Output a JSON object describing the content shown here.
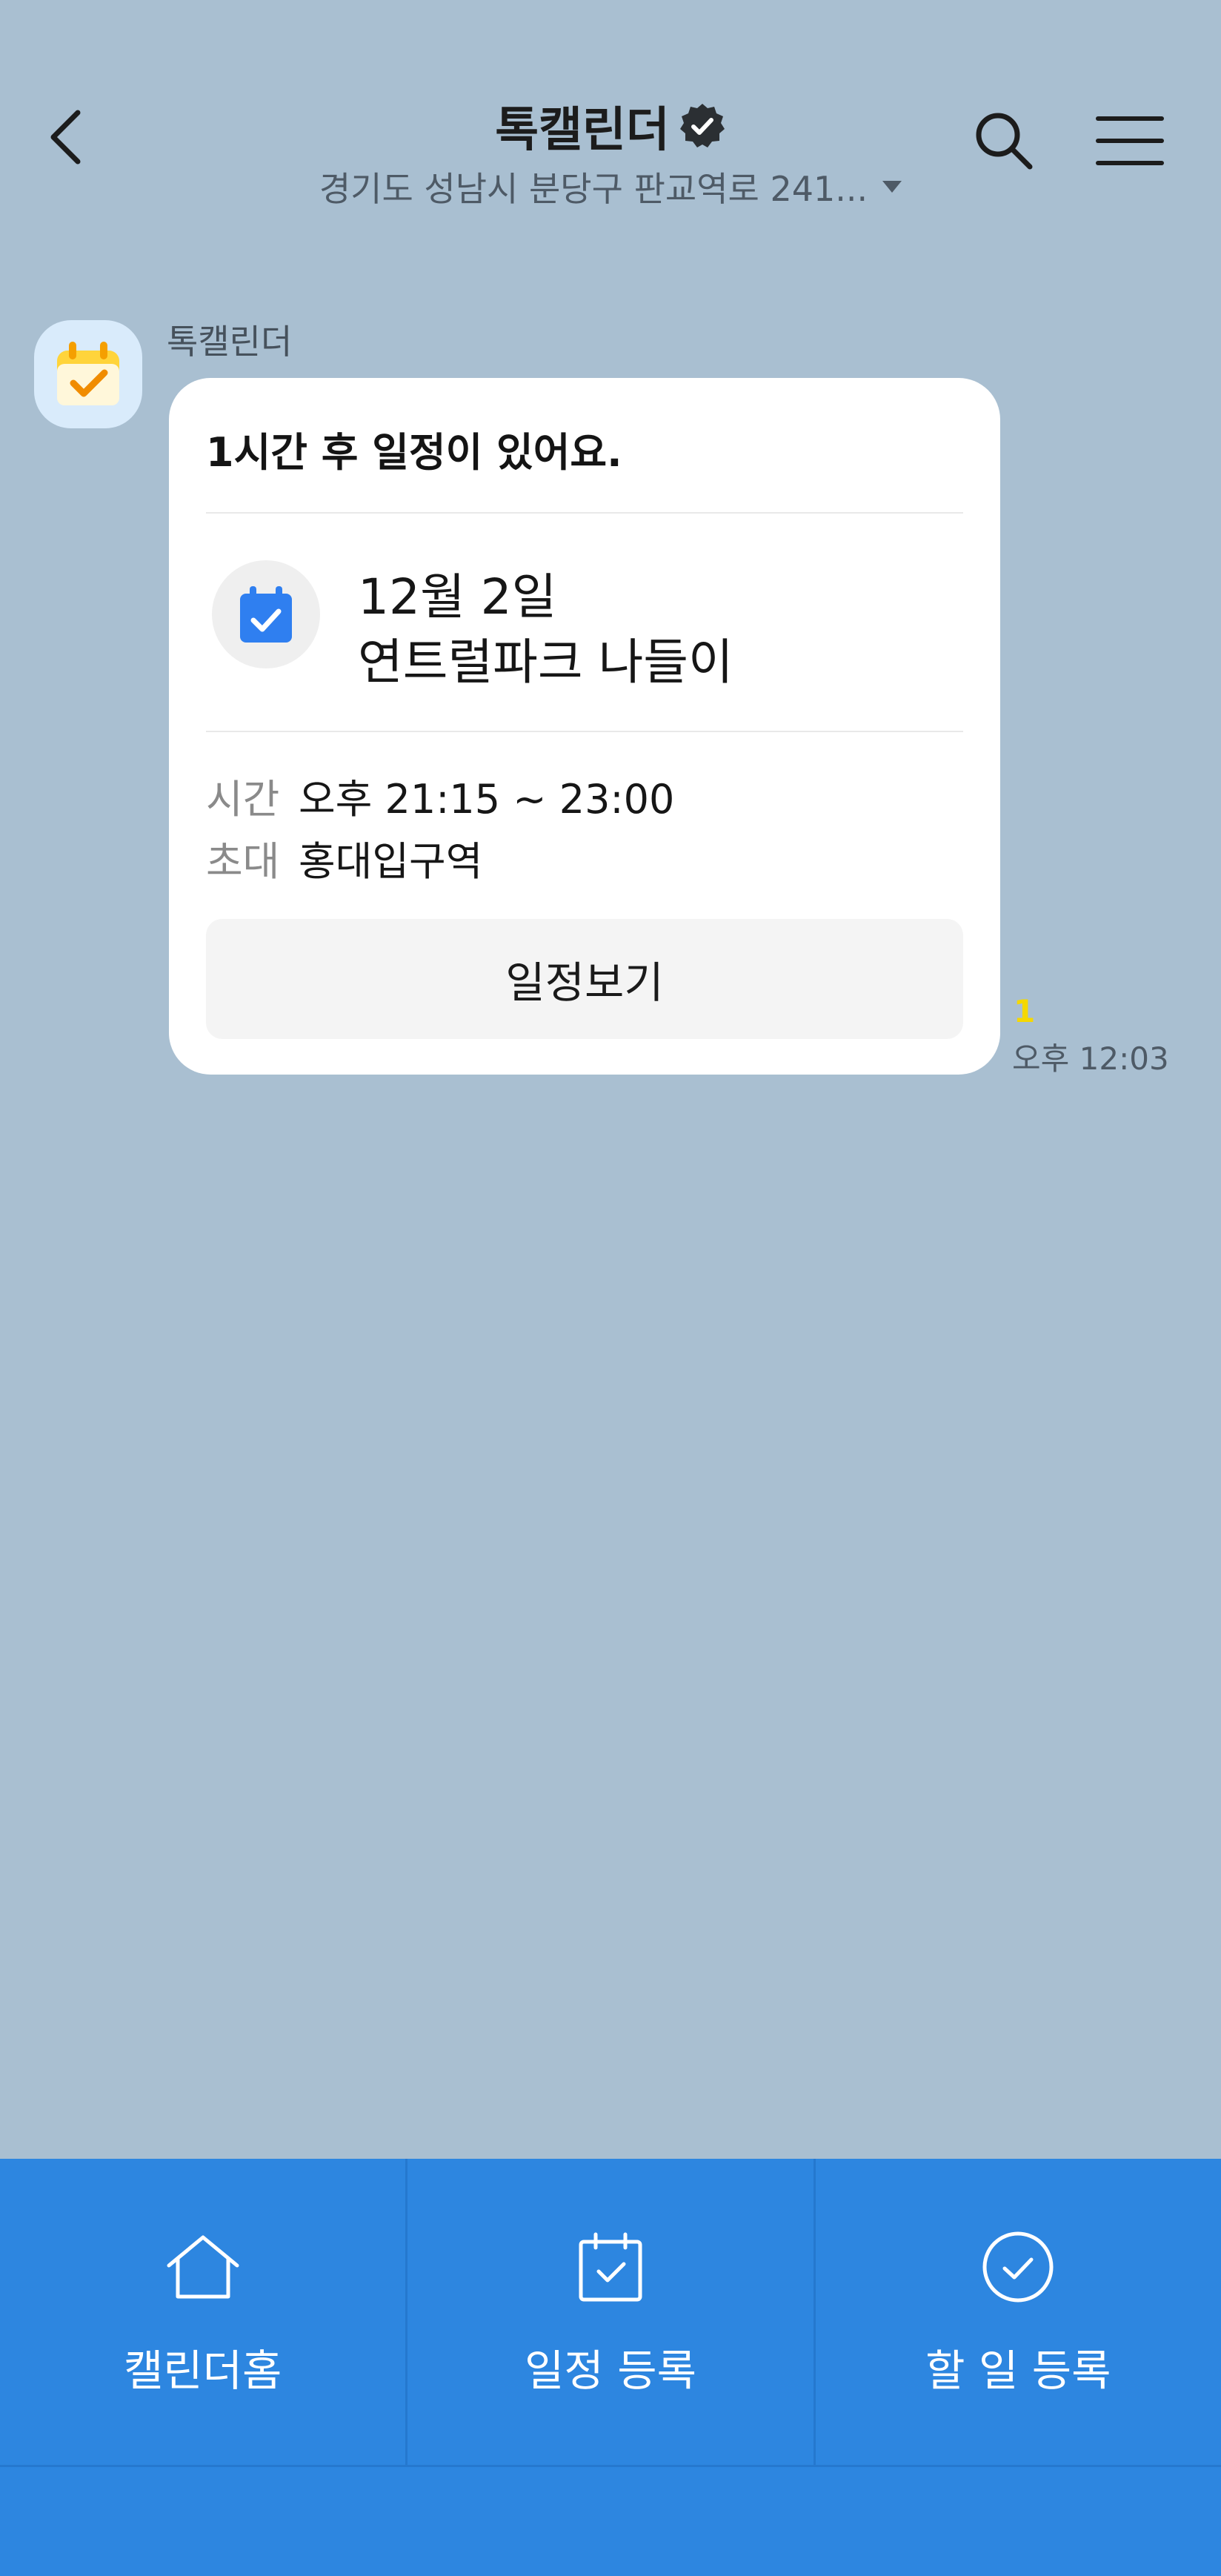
{
  "header": {
    "title": "톡캘린더",
    "subtitle": "경기도 성남시 분당구 판교역로 241..."
  },
  "message": {
    "sender": "톡캘린더",
    "heading": "1시간 후 일정이 있어요.",
    "event_date": "12월 2일",
    "event_name": "연트럴파크 나들이",
    "time_label": "시간",
    "time_value": "오후 21:15 ~ 23:00",
    "invite_label": "초대",
    "invite_value": "홍대입구역",
    "view_button": "일정보기",
    "unread": "1",
    "timestamp": "오후 12:03"
  },
  "bottom_menu": {
    "items": [
      {
        "label": "캘린더홈",
        "icon": "home-icon"
      },
      {
        "label": "일정 등록",
        "icon": "calendar-check-icon"
      },
      {
        "label": "할 일 등록",
        "icon": "check-circle-icon"
      }
    ]
  },
  "colors": {
    "background": "#a9bfd1",
    "bottom_bar": "#2d86e0",
    "accent_blue": "#2f7ff0",
    "unread_yellow": "#f5d800"
  }
}
